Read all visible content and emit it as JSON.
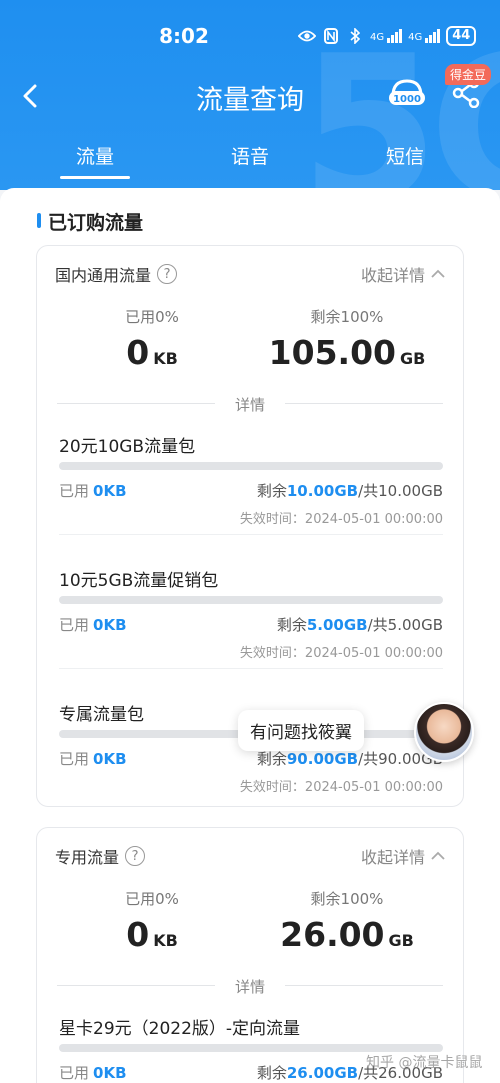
{
  "status_bar": {
    "time": "8:02",
    "signal1": "4G",
    "signal2": "4G",
    "battery": "44"
  },
  "nav": {
    "title": "流量查询",
    "badge": "得金豆",
    "service_icon_text": "1000"
  },
  "tabs": [
    {
      "label": "流量",
      "active": true
    },
    {
      "label": "语音",
      "active": false
    },
    {
      "label": "短信",
      "active": false
    }
  ],
  "section": {
    "title": "已订购流量"
  },
  "card1": {
    "title": "国内通用流量",
    "collapse_label": "收起详情",
    "used_label": "已用0%",
    "used_value": "0",
    "used_unit": "KB",
    "remain_label": "剩余100%",
    "remain_value": "105.00",
    "remain_unit": "GB",
    "divider_label": "详情",
    "packages": [
      {
        "name": "20元10GB流量包",
        "used_prefix": "已用",
        "used": "0KB",
        "remain_prefix": "剩余",
        "remain": "10.00GB",
        "total": "/共10.00GB",
        "expire": "失效时间：2024-05-01 00:00:00"
      },
      {
        "name": "10元5GB流量促销包",
        "used_prefix": "已用",
        "used": "0KB",
        "remain_prefix": "剩余",
        "remain": "5.00GB",
        "total": "/共5.00GB",
        "expire": "失效时间：2024-05-01 00:00:00"
      },
      {
        "name": "专属流量包",
        "used_prefix": "已用",
        "used": "0KB",
        "remain_prefix": "剩余",
        "remain": "90.00GB",
        "total": "/共90.00GB",
        "expire": "失效时间：2024-05-01 00:00:00"
      }
    ]
  },
  "card2": {
    "title": "专用流量",
    "collapse_label": "收起详情",
    "used_label": "已用0%",
    "used_value": "0",
    "used_unit": "KB",
    "remain_label": "剩余100%",
    "remain_value": "26.00",
    "remain_unit": "GB",
    "divider_label": "详情",
    "packages": [
      {
        "name": "星卡29元（2022版）-定向流量",
        "used_prefix": "已用",
        "used": "0KB",
        "remain_prefix": "剩余",
        "remain": "26.00GB",
        "total": "/共26.00GB"
      }
    ]
  },
  "assistant": {
    "bubble": "有问题找筱翼"
  },
  "watermark": "知乎 @流量卡鼠鼠",
  "colors": {
    "header_blue": "#1f8ff0",
    "accent_blue": "#1e8ef0",
    "badge_red": "#f36a5a"
  }
}
